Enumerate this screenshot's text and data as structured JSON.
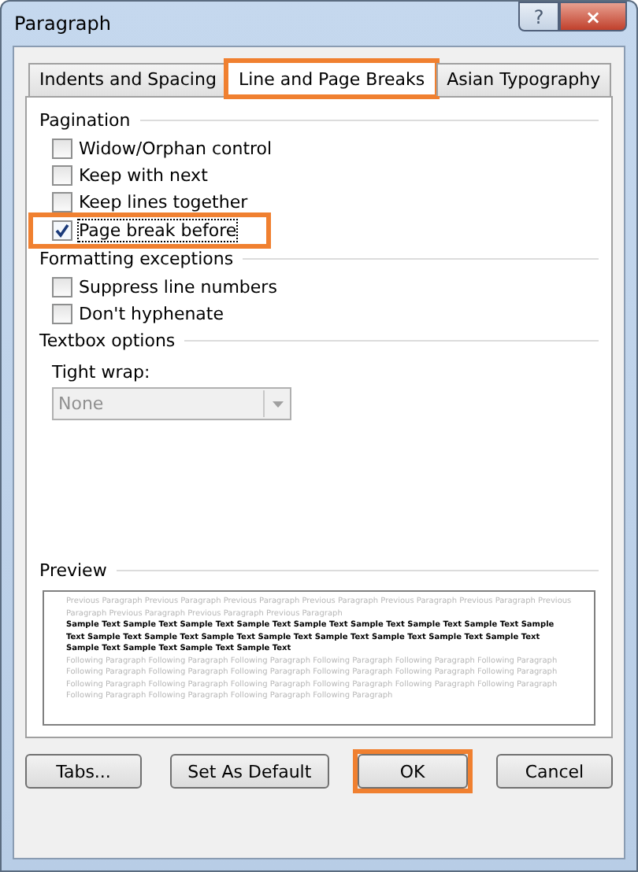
{
  "window": {
    "title": "Paragraph",
    "help": "?",
    "close": "×"
  },
  "tabs": [
    {
      "label": "Indents and Spacing",
      "selected": false,
      "highlighted": false
    },
    {
      "label": "Line and Page Breaks",
      "selected": true,
      "highlighted": true
    },
    {
      "label": "Asian Typography",
      "selected": false,
      "highlighted": false
    }
  ],
  "sections": [
    {
      "title": "Pagination",
      "checkboxes": [
        {
          "label": "Widow/Orphan control",
          "checked": false,
          "highlighted": false
        },
        {
          "label": "Keep with next",
          "checked": false,
          "highlighted": false
        },
        {
          "label": "Keep lines together",
          "checked": false,
          "highlighted": false
        },
        {
          "label": "Page break before",
          "checked": true,
          "highlighted": true
        }
      ]
    },
    {
      "title": "Formatting exceptions",
      "checkboxes": [
        {
          "label": "Suppress line numbers",
          "checked": false,
          "highlighted": false
        },
        {
          "label": "Don't hyphenate",
          "checked": false,
          "highlighted": false
        }
      ]
    },
    {
      "title": "Textbox options",
      "dropdown": {
        "label": "Tight wrap:",
        "value": "None",
        "disabled": true
      }
    }
  ],
  "preview": {
    "title": "Preview",
    "paragraphs": [
      {
        "kind": "previous",
        "text": "Previous Paragraph Previous Paragraph Previous Paragraph Previous Paragraph Previous Paragraph Previous Paragraph Previous Paragraph Previous Paragraph Previous Paragraph Previous Paragraph"
      },
      {
        "kind": "sample",
        "text": "Sample Text Sample Text Sample Text Sample Text Sample Text Sample Text Sample Text Sample Text Sample Text Sample Text Sample Text Sample Text Sample Text Sample Text Sample Text Sample Text Sample Text Sample Text Sample Text Sample Text Sample Text"
      },
      {
        "kind": "following",
        "text": "Following Paragraph Following Paragraph Following Paragraph Following Paragraph Following Paragraph Following Paragraph Following Paragraph Following Paragraph Following Paragraph Following Paragraph Following Paragraph Following Paragraph Following Paragraph Following Paragraph Following Paragraph Following Paragraph Following Paragraph Following Paragraph Following Paragraph Following Paragraph Following Paragraph Following Paragraph"
      }
    ]
  },
  "buttons": [
    {
      "label": "Tabs...",
      "highlighted": false
    },
    {
      "label": "Set As Default",
      "highlighted": false
    },
    {
      "label": "OK",
      "highlighted": true
    },
    {
      "label": "Cancel",
      "highlighted": false
    }
  ]
}
